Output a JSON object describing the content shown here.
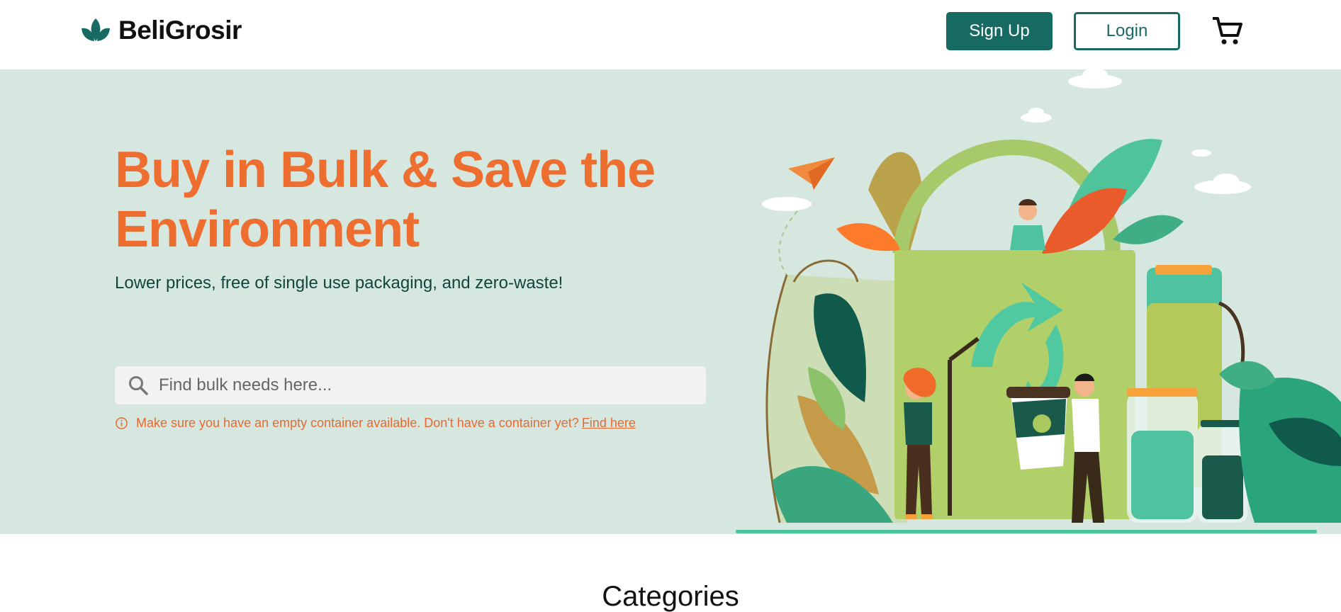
{
  "header": {
    "brand": "BeliGrosir",
    "signup_label": "Sign Up",
    "login_label": "Login",
    "cart_icon": "cart-icon"
  },
  "hero": {
    "title": "Buy in Bulk & Save the Environment",
    "subtitle": "Lower prices, free of single use packaging, and zero-waste!",
    "search_placeholder": "Find bulk needs here...",
    "notice_text": "Make sure you have an empty container available. Don't have a container yet?",
    "notice_link": "Find here"
  },
  "sections": {
    "categories_title": "Categories"
  },
  "colors": {
    "brand_green": "#176a62",
    "accent_orange": "#ee6e2f",
    "hero_bg": "#d6e7e0"
  }
}
